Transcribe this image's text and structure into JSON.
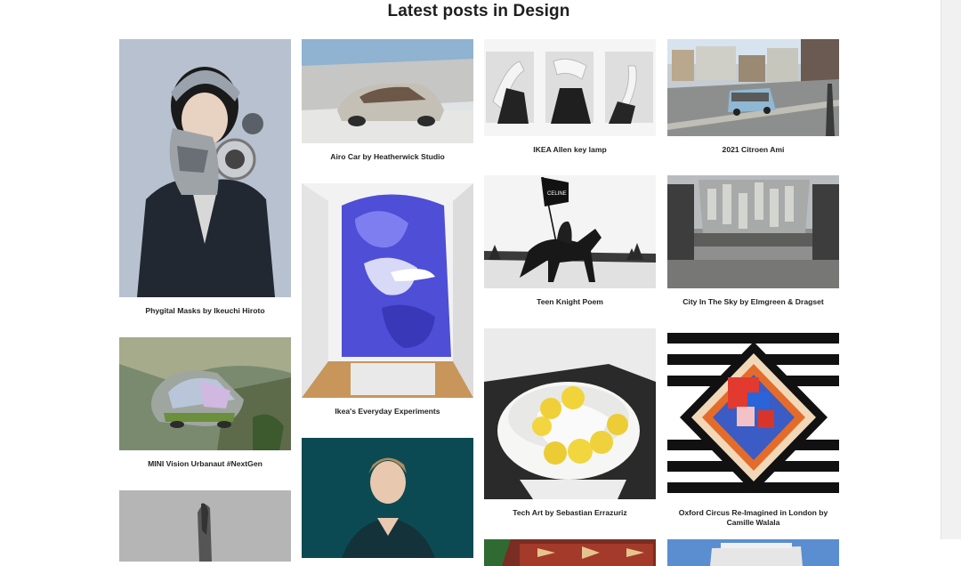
{
  "page": {
    "title": "Latest posts in Design"
  },
  "posts": [
    {
      "caption": "Phygital Masks by Ikeuchi Hiroto"
    },
    {
      "caption": "MINI Vision Urbanaut #NextGen"
    },
    {
      "caption": ""
    },
    {
      "caption": "Airo Car by Heatherwick Studio"
    },
    {
      "caption": "Ikea's Everyday Experiments"
    },
    {
      "caption": ""
    },
    {
      "caption": "IKEA Allen key lamp"
    },
    {
      "caption": "Teen Knight Poem"
    },
    {
      "caption": "Tech Art by Sebastian Errazuriz"
    },
    {
      "caption": ""
    },
    {
      "caption": "2021 Citroen Ami"
    },
    {
      "caption": "City In The Sky by Elmgreen & Dragset"
    },
    {
      "caption": "Oxford Circus Re-Imagined in London by Camille Walala"
    },
    {
      "caption": ""
    }
  ],
  "flag_text": "CELINE"
}
